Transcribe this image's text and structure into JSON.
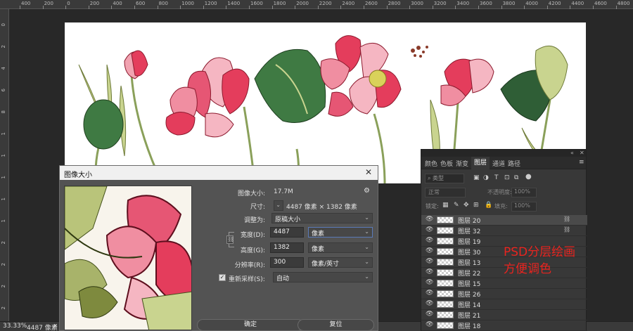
{
  "ruler": {
    "top_labels": [
      "400",
      "200",
      "0",
      "200",
      "400",
      "600",
      "800",
      "1000",
      "1200",
      "1400",
      "1600",
      "1800",
      "2000",
      "2200",
      "2400",
      "2600",
      "2800",
      "3000",
      "3200",
      "3400",
      "3600",
      "3800",
      "4000",
      "4200",
      "4400",
      "4600",
      "4800"
    ],
    "left_labels": [
      "0",
      "2",
      "4",
      "6",
      "8",
      "1",
      "1",
      "1",
      "1",
      "1",
      "2",
      "2",
      "2",
      "2"
    ]
  },
  "status": {
    "zoom": "33.33%",
    "size": "4487 像素",
    "close": "x"
  },
  "dialog": {
    "title": "图像大小",
    "close": "✕",
    "image_size_label": "图像大小:",
    "image_size_value": "17.7M",
    "gear": "⚙",
    "dimensions_label": "尺寸:",
    "dimensions_value": "4487 像素  ×  1382 像素",
    "fit_label": "调整为:",
    "fit_value": "原稿大小",
    "width_label": "宽度(D):",
    "width_value": "4487",
    "width_unit": "像素",
    "height_label": "高度(G):",
    "height_value": "1382",
    "height_unit": "像素",
    "resolution_label": "分辨率(R):",
    "resolution_value": "300",
    "resolution_unit": "像素/英寸",
    "resample_label": "重新采样(S):",
    "resample_value": "自动",
    "ok": "确定",
    "reset": "复位"
  },
  "panel": {
    "collapse": "«",
    "close": "✕",
    "tabs": [
      "颜色",
      "色板",
      "渐变",
      "图层",
      "通道",
      "路径"
    ],
    "active_tab": "图层",
    "menu": "≡",
    "filter_placeholder": "类型",
    "blend_mode": "正常",
    "opacity_label": "不透明度:",
    "opacity_value": "100%",
    "lock_label": "锁定:",
    "fill_label": "填充:",
    "fill_value": "100%",
    "layers": [
      {
        "name": "图层 20",
        "linked": true
      },
      {
        "name": "图层 32",
        "linked": true
      },
      {
        "name": "图层 19",
        "linked": false
      },
      {
        "name": "图层 30",
        "linked": false
      },
      {
        "name": "图层 13",
        "linked": false
      },
      {
        "name": "图层 22",
        "linked": false
      },
      {
        "name": "图层 15",
        "linked": false
      },
      {
        "name": "图层 26",
        "linked": false
      },
      {
        "name": "图层 14",
        "linked": false
      },
      {
        "name": "图层 21",
        "linked": false
      },
      {
        "name": "图层 18",
        "linked": false
      }
    ]
  },
  "overlay_text": {
    "line1": "PSD分层绘画",
    "line2": "方便调色"
  },
  "colors": {
    "overlay": "#e8241f",
    "lotus_pink": "#e43d5c",
    "leaf_green": "#3f7a43"
  }
}
